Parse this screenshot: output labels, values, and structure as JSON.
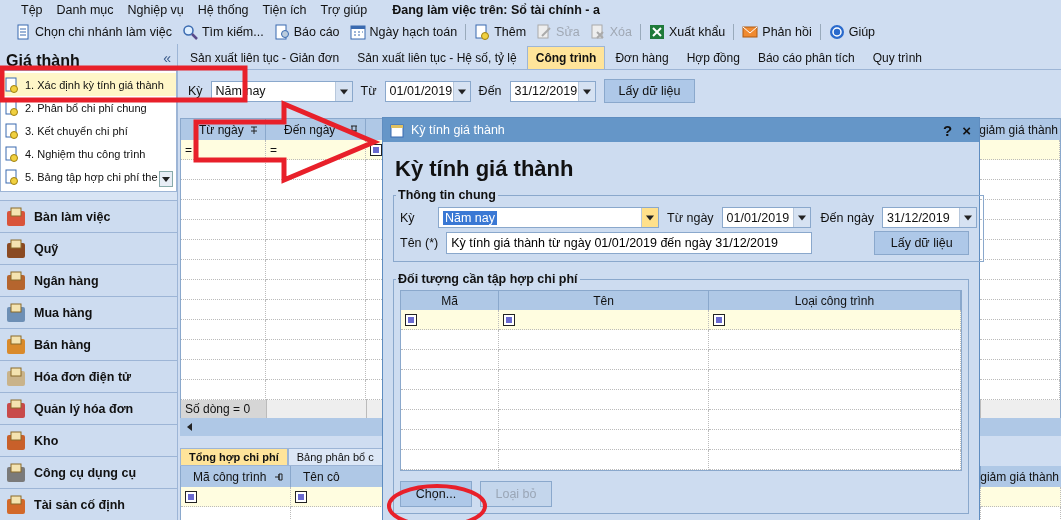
{
  "menu_bar": {
    "items": [
      "Tệp",
      "Danh mục",
      "Nghiệp vụ",
      "Hệ thống",
      "Tiện ích",
      "Trợ giúp"
    ],
    "status": "Đang làm việc trên: Sổ tài chính - a"
  },
  "toolbar": {
    "groups": [
      [
        {
          "label": "Chọn chi nhánh làm việc",
          "disabled": false
        },
        {
          "label": "Tìm kiếm...",
          "disabled": false
        },
        {
          "label": "Báo cáo",
          "disabled": false
        },
        {
          "label": "Ngày hạch toán",
          "disabled": false
        }
      ],
      [
        {
          "label": "Thêm",
          "disabled": false
        },
        {
          "label": "Sửa",
          "disabled": true
        },
        {
          "label": "Xóa",
          "disabled": true
        }
      ],
      [
        {
          "label": "Xuất khẩu",
          "disabled": false
        }
      ],
      [
        {
          "label": "Phản hồi",
          "disabled": false
        }
      ],
      [
        {
          "label": "Giúp",
          "disabled": false
        }
      ]
    ]
  },
  "sidebar": {
    "title": "Giá thành",
    "collapse": "«",
    "tasks": [
      {
        "label": "1. Xác định kỳ tính giá thành",
        "selected": true
      },
      {
        "label": "2. Phân bổ chi phí chung",
        "selected": false
      },
      {
        "label": "3. Kết chuyển chi phí",
        "selected": false
      },
      {
        "label": "4. Nghiệm thu công trình",
        "selected": false
      },
      {
        "label": "5. Bảng tập hợp chi phí the",
        "selected": false
      }
    ],
    "modules": [
      "Bàn làm việc",
      "Quỹ",
      "Ngân hàng",
      "Mua hàng",
      "Bán hàng",
      "Hóa đơn điện tử",
      "Quản lý hóa đơn",
      "Kho",
      "Công cụ dụng cụ",
      "Tài sản cố định"
    ]
  },
  "tabs": [
    {
      "label": "Sản xuất liên tục - Giản đơn",
      "selected": false
    },
    {
      "label": "Sản xuất liên tục - Hệ số, tỷ lệ",
      "selected": false
    },
    {
      "label": "Công trình",
      "selected": true
    },
    {
      "label": "Đơn hàng",
      "selected": false
    },
    {
      "label": "Hợp đồng",
      "selected": false
    },
    {
      "label": "Báo cáo phân tích",
      "selected": false
    },
    {
      "label": "Quy trình",
      "selected": false
    }
  ],
  "filter": {
    "period_label": "Kỳ",
    "period": "Năm nay",
    "from_label": "Từ",
    "from": "01/01/2019",
    "to_label": "Đến",
    "to": "31/12/2019",
    "button": "Lấy dữ liệu"
  },
  "main_grid": {
    "columns": [
      "Từ ngày",
      "Đến ngày"
    ],
    "far_column": "giảm giá thành",
    "filter_marks": [
      "=",
      "="
    ],
    "row_count": "Số dòng = 0"
  },
  "bottom_tabs": [
    {
      "label": "Tổng hợp chi phí",
      "selected": true
    },
    {
      "label": "Bảng phân bổ c",
      "selected": false
    }
  ],
  "bottom_grid": {
    "columns": [
      "Mã công trình",
      "Tên cô"
    ],
    "far_column": "giảm giá thành"
  },
  "dialog": {
    "title": "Kỳ tính giá thành",
    "help": "?",
    "close": "×",
    "heading": "Kỳ tính giá thành",
    "general": {
      "legend": "Thông tin chung",
      "period_label": "Kỳ",
      "period": "Năm nay",
      "from_label": "Từ ngày",
      "from": "01/01/2019",
      "to_label": "Đến ngày",
      "to": "31/12/2019",
      "name_label": "Tên (*)",
      "name": "Kỳ tính giá thành từ ngày 01/01/2019 đến ngày 31/12/2019",
      "button": "Lấy dữ liệu"
    },
    "objects": {
      "legend": "Đối tượng cần tập hợp chi phí",
      "columns": [
        "Mã",
        "Tên",
        "Loại công trình"
      ]
    },
    "buttons": [
      {
        "label": "Chọn...",
        "disabled": false
      },
      {
        "label": "Loại bỏ",
        "disabled": true
      }
    ]
  }
}
